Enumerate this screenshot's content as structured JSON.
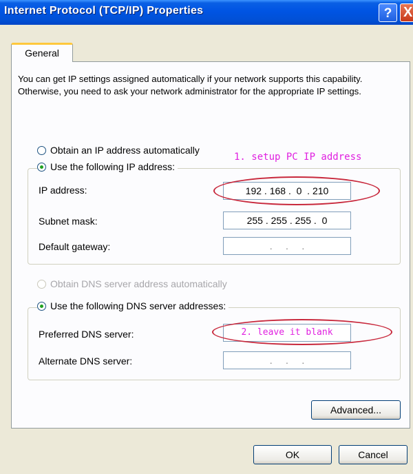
{
  "window": {
    "title": "Internet Protocol (TCP/IP) Properties",
    "help_label": "?",
    "close_label": "X"
  },
  "tab": {
    "label": "General"
  },
  "description": "You can get IP settings assigned automatically if your network supports this capability. Otherwise, you need to ask your network administrator for the appropriate IP settings.",
  "ip_section": {
    "auto_option": "Obtain an IP address automatically",
    "manual_option": "Use the following IP address:",
    "selected": "manual",
    "fields": [
      {
        "label": "IP address:",
        "value": "192 . 168 .  0  . 210"
      },
      {
        "label": "Subnet mask:",
        "value": "255 . 255 . 255 .  0"
      },
      {
        "label": "Default gateway:",
        "value": " .     .     . "
      }
    ]
  },
  "dns_section": {
    "auto_option": "Obtain DNS server address automatically",
    "manual_option": "Use the following DNS server addresses:",
    "selected": "manual",
    "auto_disabled": true,
    "fields": [
      {
        "label": "Preferred DNS server:",
        "value": "2. leave it blank"
      },
      {
        "label": "Alternate DNS server:",
        "value": " .     .     . "
      }
    ]
  },
  "annotations": {
    "note1": "1. setup PC IP address",
    "note2": "2. leave it blank",
    "color": "#e020e0",
    "ellipse_color": "#c8283c"
  },
  "buttons": {
    "advanced": "Advanced...",
    "ok": "OK",
    "cancel": "Cancel"
  },
  "colors": {
    "titlebar": "#0054e3",
    "dialog_bg": "#ece9d8",
    "panel_bg": "#fcfcfe",
    "tab_highlight": "#ffc83c"
  }
}
